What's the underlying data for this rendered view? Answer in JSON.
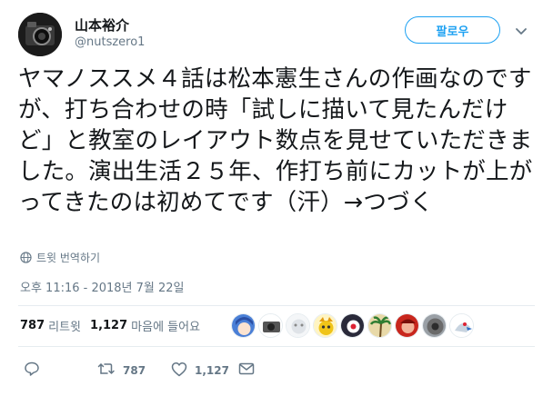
{
  "author": {
    "display_name": "山本裕介",
    "handle": "@nutszero1"
  },
  "follow_label": "팔로우",
  "tweet": {
    "text": "ヤマノススメ４話は松本憲生さんの作画なのですが、打ち合わせの時「試しに描いて見たんだけど」と教室のレイアウト数点を見せていただきました。演出生活２５年、作打ち前にカットが上がってきたのは初めてです（汗）→つづく",
    "translate_label": "트윗 번역하기",
    "timestamp": "오후 11:16 - 2018년 7월 22일"
  },
  "stats": {
    "retweets": "787",
    "retweets_label": "리트윗",
    "likes": "1,127",
    "likes_label": "마음에 들어요"
  },
  "likers": [
    {
      "icon": "liker-avatar-1",
      "color": "#4a7fd6"
    },
    {
      "icon": "liker-avatar-2",
      "color": "#555555"
    },
    {
      "icon": "liker-avatar-3",
      "color": "#dfe3e8"
    },
    {
      "icon": "liker-avatar-4",
      "color": "#f0c419"
    },
    {
      "icon": "liker-avatar-5",
      "color": "#2a2a3a"
    },
    {
      "icon": "liker-avatar-6",
      "color": "#e8d9a8"
    },
    {
      "icon": "liker-avatar-7",
      "color": "#c8261d"
    },
    {
      "icon": "liker-avatar-8",
      "color": "#6a6a6a"
    },
    {
      "icon": "liker-avatar-9",
      "color": "#c8d4e0"
    }
  ],
  "actions": {
    "retweet_count": "787",
    "like_count": "1,127"
  },
  "colors": {
    "accent": "#1da1f2",
    "text": "#14171a",
    "muted": "#657786",
    "divider": "#e6ecf0"
  }
}
